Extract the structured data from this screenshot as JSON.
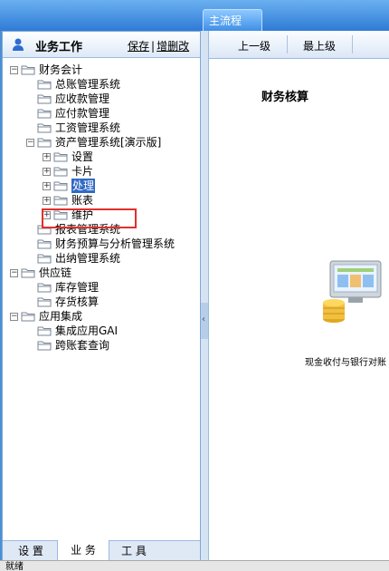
{
  "top_tab": "主流程",
  "left_panel": {
    "title": "业务工作",
    "save_link": "保存",
    "add_del_link": "增删改"
  },
  "tree": [
    {
      "label": "财务会计",
      "toggle": "−"
    },
    {
      "label": "总账管理系统"
    },
    {
      "label": "应收款管理"
    },
    {
      "label": "应付款管理"
    },
    {
      "label": "工资管理系统"
    },
    {
      "label": "资产管理系统[演示版]",
      "toggle": "−"
    },
    {
      "label": "设置",
      "toggle": "+"
    },
    {
      "label": "卡片",
      "toggle": "+"
    },
    {
      "label": "处理",
      "toggle": "+",
      "selected": true
    },
    {
      "label": "账表",
      "toggle": "+"
    },
    {
      "label": "维护",
      "toggle": "+"
    },
    {
      "label": "报表管理系统"
    },
    {
      "label": "财务预算与分析管理系统"
    },
    {
      "label": "出纳管理系统"
    },
    {
      "label": "供应链",
      "toggle": "−"
    },
    {
      "label": "库存管理"
    },
    {
      "label": "存货核算"
    },
    {
      "label": "应用集成",
      "toggle": "−"
    },
    {
      "label": "集成应用GAI"
    },
    {
      "label": "跨账套查询"
    }
  ],
  "bottom_tabs": [
    "设 置",
    "业 务",
    "工 具"
  ],
  "toolbar": {
    "up_label": "上一级",
    "top_label": "最上级"
  },
  "right": {
    "section_title": "财务核算",
    "cash_label": "现金收付与银行对账"
  },
  "status_text": "就绪",
  "colors": {
    "accent": "#316ac5",
    "highlight_box": "#e2302a",
    "title_bar": "#2f7bd6"
  }
}
